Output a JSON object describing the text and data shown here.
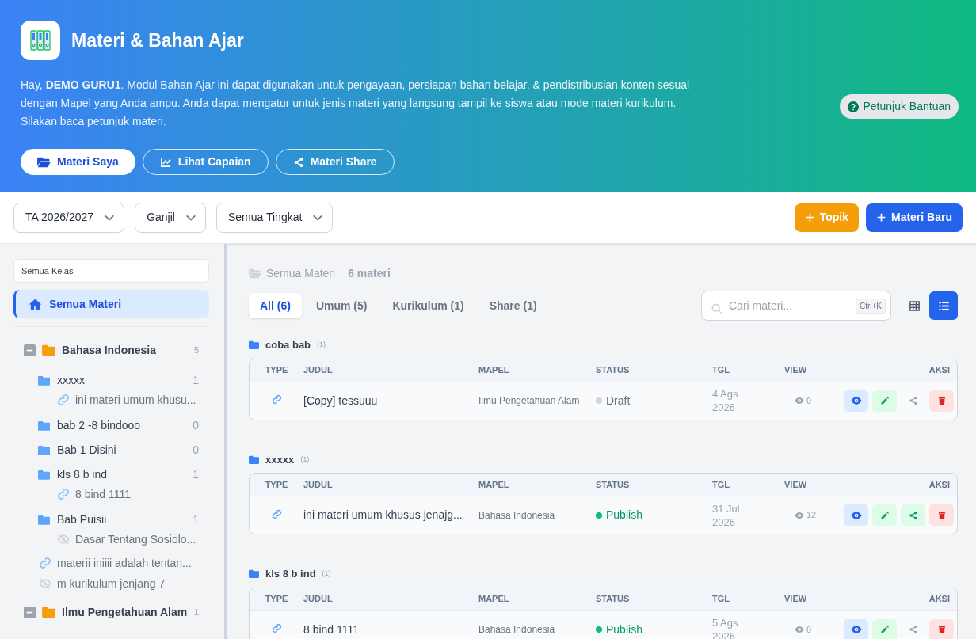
{
  "header": {
    "title": "Materi & Bahan Ajar",
    "intro": "Hay, **DEMO GURU1**. Modul Bahan Ajar ini dapat digunakan untuk pengayaan, persiapan bahan belajar, & pendistribusian konten sesuai dengan Mapel yang Anda ampu. Anda dapat mengatur untuk jenis materi yang langsung tampil ke siswa atau mode materi kurikulum. Silakan baca petunjuk materi.",
    "help_button": "Petunjuk Bantuan",
    "nav_buttons": [
      {
        "label": "Materi Saya",
        "kind": "folder",
        "selected": true
      },
      {
        "label": "Lihat Capaian",
        "kind": "chart",
        "selected": false
      },
      {
        "label": "Materi Share",
        "kind": "share",
        "selected": false
      }
    ]
  },
  "toolbar": {
    "filters": [
      {
        "value": "TA 2026/2027"
      },
      {
        "value": "Ganjil"
      },
      {
        "value": "Semua Tingkat"
      }
    ],
    "actions": [
      {
        "label": "Topik",
        "kind": "topic"
      },
      {
        "label": "Materi Baru",
        "kind": "new"
      }
    ]
  },
  "sidebar": {
    "class_filter": "Semua Kelas",
    "all_item": {
      "label": "Semua Materi",
      "selected": true
    },
    "subjects": [
      {
        "name": "Bahasa Indonesia",
        "count": "5",
        "expanded": true,
        "children": [
          {
            "kind": "folder",
            "name": "xxxxx",
            "count": "1",
            "children": [
              {
                "kind": "link",
                "title": "ini materi umum khusu..."
              }
            ]
          },
          {
            "kind": "folder",
            "name": "bab 2 -8 bindooo",
            "count": "0"
          },
          {
            "kind": "folder",
            "name": "Bab 1 Disini",
            "count": "0"
          },
          {
            "kind": "folder",
            "name": "kls 8 b ind",
            "count": "1",
            "children": [
              {
                "kind": "link",
                "title": "8 bind 1111"
              }
            ]
          },
          {
            "kind": "folder",
            "name": "Bab Puisii",
            "count": "1",
            "children": [
              {
                "kind": "hidden",
                "title": "Dasar Tentang Sosiolo..."
              }
            ]
          },
          {
            "kind": "link",
            "title": "materii iniiii adalah tentan..."
          },
          {
            "kind": "hidden",
            "title": "m kurikulum jenjang 7"
          }
        ]
      },
      {
        "name": "Ilmu Pengetahuan Alam",
        "count": "1",
        "expanded": true
      }
    ]
  },
  "main": {
    "breadcrumb": "Semua Materi",
    "total": "6 materi",
    "tabs": [
      {
        "label": "All (6)",
        "selected": true
      },
      {
        "label": "Umum (5)",
        "selected": false
      },
      {
        "label": "Kurikulum (1)",
        "selected": false
      },
      {
        "label": "Share (1)",
        "selected": false
      }
    ],
    "search": {
      "placeholder": "Cari materi...",
      "shortcut": "Ctrl+K"
    },
    "views": [
      {
        "kind": "grid",
        "selected": false
      },
      {
        "kind": "list",
        "selected": true
      }
    ],
    "groups": [
      {
        "name": "coba bab",
        "count": "(1)",
        "columns": [
          "TYPE",
          "JUDUL",
          "MAPEL",
          "STATUS",
          "TGL",
          "VIEW",
          "AKSI"
        ],
        "rows": [
          {
            "title": "[Copy] tessuuu",
            "subject": "Ilmu Pengetahuan Alam",
            "status": "Draft",
            "published": false,
            "date": "4 Ags 2026",
            "views": "0",
            "shared": false
          }
        ]
      },
      {
        "name": "xxxxx",
        "count": "(1)",
        "columns": [
          "TYPE",
          "JUDUL",
          "MAPEL",
          "STATUS",
          "TGL",
          "VIEW",
          "AKSI"
        ],
        "rows": [
          {
            "title": "ini materi umum khusus jenajg...",
            "subject": "Bahasa Indonesia",
            "status": "Publish",
            "published": true,
            "date": "31 Jul 2026",
            "views": "12",
            "shared": true
          }
        ]
      },
      {
        "name": "kls 8 b ind",
        "count": "(1)",
        "columns": [
          "TYPE",
          "JUDUL",
          "MAPEL",
          "STATUS",
          "TGL",
          "VIEW",
          "AKSI"
        ],
        "rows": [
          {
            "title": "8 bind 1111",
            "subject": "Bahasa Indonesia",
            "status": "Publish",
            "published": true,
            "date": "5 Ags 2026",
            "views": "0",
            "shared": false
          }
        ]
      }
    ]
  }
}
